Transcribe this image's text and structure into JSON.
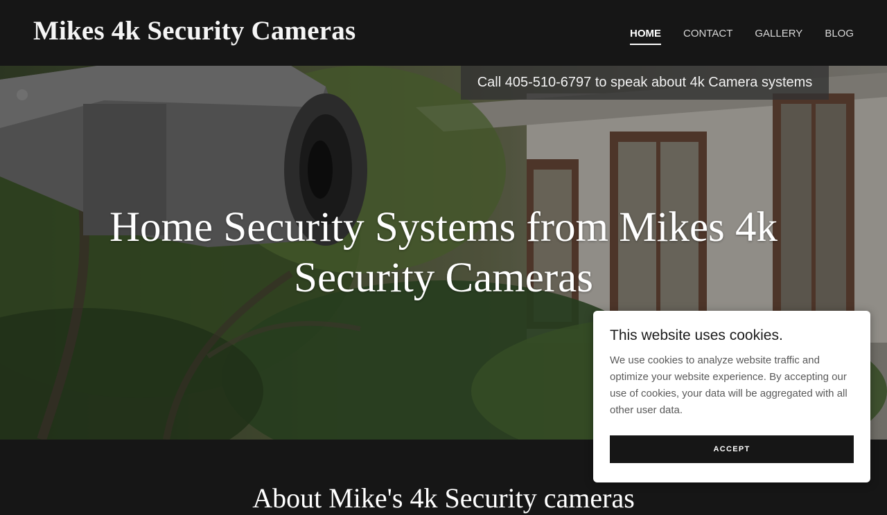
{
  "header": {
    "logo": "Mikes 4k Security Cameras",
    "nav": [
      {
        "label": "HOME",
        "active": true
      },
      {
        "label": "CONTACT",
        "active": false
      },
      {
        "label": "GALLERY",
        "active": false
      },
      {
        "label": "BLOG",
        "active": false
      }
    ]
  },
  "hero": {
    "call_banner": "Call 405-510-6797 to speak about 4k Camera systems",
    "title": "Home Security Systems from Mikes 4k Security Cameras"
  },
  "about": {
    "heading": "About Mike's 4k Security cameras"
  },
  "cookie_banner": {
    "title": "This website uses cookies.",
    "text": "We use cookies to analyze website traffic and optimize your website experience. By accepting our use of cookies, your data will be aggregated with all other user data.",
    "accept_label": "ACCEPT"
  }
}
